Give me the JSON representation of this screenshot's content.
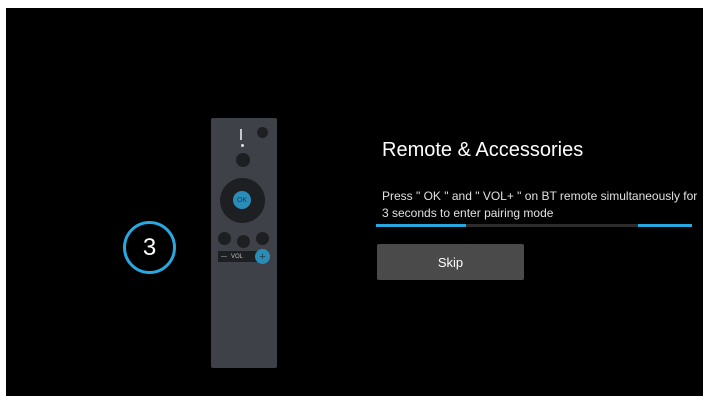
{
  "step": {
    "number": "3"
  },
  "remote": {
    "ok_label": "OK",
    "vol_minus": "—",
    "vol_label": "VOL",
    "vol_plus": "+"
  },
  "title": "Remote & Accessories",
  "instructions": "Press \" OK \" and \" VOL+ \" on BT remote simultaneously for 3 seconds to enter pairing mode",
  "skip_label": "Skip",
  "colors": {
    "accent": "#29a8e0",
    "background": "#000000",
    "button": "#4a4a4a"
  }
}
